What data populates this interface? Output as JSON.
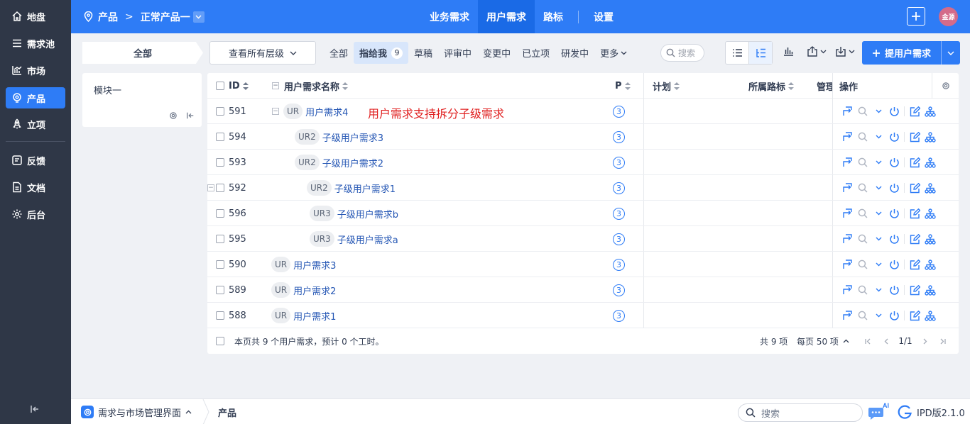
{
  "sidebar": {
    "items": [
      {
        "label": "地盘",
        "icon": "home-icon"
      },
      {
        "label": "需求池",
        "icon": "list-icon"
      },
      {
        "label": "市场",
        "icon": "chart-icon"
      },
      {
        "label": "产品",
        "icon": "bulb-icon",
        "active": true
      },
      {
        "label": "立项",
        "icon": "rocket-icon"
      },
      {
        "label": "反馈",
        "icon": "feedback-icon"
      },
      {
        "label": "文档",
        "icon": "doc-icon"
      },
      {
        "label": "后台",
        "icon": "gear-icon"
      }
    ]
  },
  "header": {
    "breadcrumb_root": "产品",
    "breadcrumb_current": "正常产品一",
    "tabs": [
      {
        "label": "业务需求"
      },
      {
        "label": "用户需求",
        "active": true
      },
      {
        "label": "路标"
      },
      {
        "label": "设置"
      }
    ],
    "avatar_text": "金源"
  },
  "toolbar": {
    "all_label": "全部",
    "level_select": "查看所有层级",
    "filters": [
      {
        "label": "全部"
      },
      {
        "label": "指给我",
        "count": "9",
        "active": true
      },
      {
        "label": "草稿"
      },
      {
        "label": "评审中"
      },
      {
        "label": "变更中"
      },
      {
        "label": "已立项"
      },
      {
        "label": "研发中"
      }
    ],
    "more_label": "更多",
    "search_placeholder": "搜索",
    "primary_button": "提用户需求"
  },
  "module_panel": {
    "label": "模块一"
  },
  "table": {
    "columns": {
      "id": "ID",
      "name": "用户需求名称",
      "priority": "P",
      "plan": "计划",
      "roadmap": "所属路标",
      "manager": "管理",
      "actions": "操作"
    },
    "annotation": "用户需求支持拆分子级需求",
    "rows": [
      {
        "id": "591",
        "tag": "UR",
        "title": "用户需求4",
        "priority": "3",
        "level": 0,
        "expandable": true
      },
      {
        "id": "594",
        "tag": "UR2",
        "title": "子级用户需求3",
        "priority": "3",
        "level": 1
      },
      {
        "id": "593",
        "tag": "UR2",
        "title": "子级用户需求2",
        "priority": "3",
        "level": 1
      },
      {
        "id": "592",
        "tag": "UR2",
        "title": "子级用户需求1",
        "priority": "3",
        "level": 1,
        "expandable": true
      },
      {
        "id": "596",
        "tag": "UR3",
        "title": "子级用户需求b",
        "priority": "3",
        "level": 2
      },
      {
        "id": "595",
        "tag": "UR3",
        "title": "子级用户需求a",
        "priority": "3",
        "level": 2
      },
      {
        "id": "590",
        "tag": "UR",
        "title": "用户需求3",
        "priority": "3",
        "level": 0
      },
      {
        "id": "589",
        "tag": "UR",
        "title": "用户需求2",
        "priority": "3",
        "level": 0
      },
      {
        "id": "588",
        "tag": "UR",
        "title": "用户需求1",
        "priority": "3",
        "level": 0
      }
    ],
    "footer": {
      "summary": "本页共 9 个用户需求，预计 0 个工时。",
      "total": "共 9 项",
      "per_page": "每页 50 项",
      "page": "1/1"
    }
  },
  "bottom_bar": {
    "app_name": "需求与市场管理界面",
    "crumb": "产品",
    "search_placeholder": "搜索",
    "ai_label": "AI",
    "version": "IPD版2.1.0"
  }
}
